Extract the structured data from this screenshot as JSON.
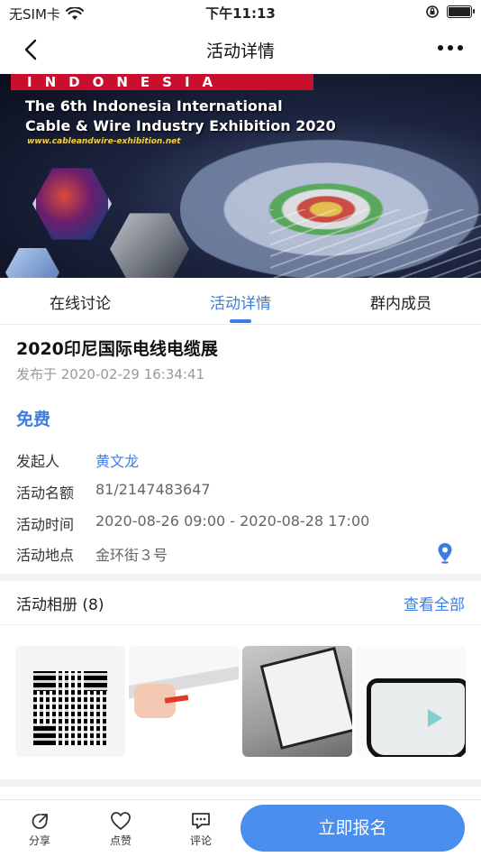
{
  "status_bar": {
    "carrier": "无SIM卡",
    "time": "下午11:13"
  },
  "nav": {
    "title": "活动详情"
  },
  "banner": {
    "country": "INDONESIA",
    "line1": "The 6th Indonesia International",
    "line2": "Cable & Wire Industry Exhibition 2020",
    "url": "www.cableandwire-exhibition.net"
  },
  "tabs": [
    {
      "label": "在线讨论",
      "active": false
    },
    {
      "label": "活动详情",
      "active": true
    },
    {
      "label": "群内成员",
      "active": false
    }
  ],
  "event": {
    "title": "2020印尼国际电线电缆展",
    "published": "发布于 2020-02-29 16:34:41",
    "price": "免费",
    "rows": [
      {
        "key": "发起人",
        "value": "黄文龙"
      },
      {
        "key": "活动名额",
        "value": "81/2147483647"
      },
      {
        "key": "活动时间",
        "value": "2020-08-26 09:00 - 2020-08-28 17:00"
      },
      {
        "key": "活动地点",
        "value": "金环街３号"
      }
    ]
  },
  "album": {
    "title": "活动相册 (8)",
    "view_all": "查看全部"
  },
  "bottom_bar": {
    "share": "分享",
    "like": "点赞",
    "comment": "评论",
    "signup": "立即报名"
  },
  "colors": {
    "accent": "#3d7de0",
    "button": "#4a8ef0"
  }
}
